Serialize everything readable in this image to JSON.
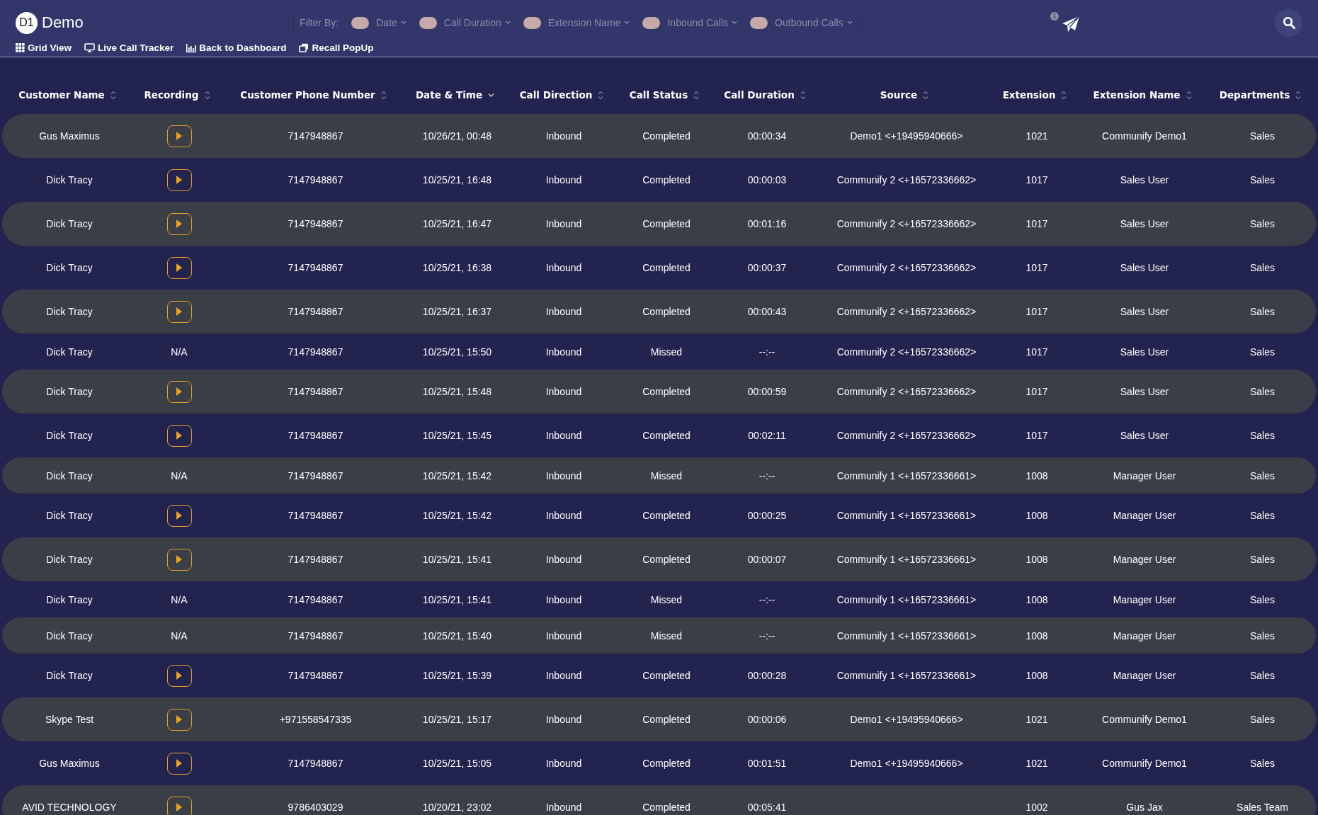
{
  "app": {
    "logo": "D1",
    "title": "Demo"
  },
  "filter": {
    "label": "Filter By:",
    "items": [
      {
        "label": "Date",
        "on": false
      },
      {
        "label": "Call Duration",
        "on": false
      },
      {
        "label": "Extension Name",
        "on": false
      },
      {
        "label": "Inbound Calls",
        "on": false
      },
      {
        "label": "Outbound Calls",
        "on": false
      }
    ]
  },
  "nav": [
    {
      "kind": "grid",
      "label": "Grid View"
    },
    {
      "kind": "monitor",
      "label": "Live Call Tracker"
    },
    {
      "kind": "chart",
      "label": "Back to Dashboard"
    },
    {
      "kind": "popup",
      "label": "Recall PopUp"
    }
  ],
  "table": {
    "columns": [
      {
        "label": "Customer Name",
        "sorted": false
      },
      {
        "label": "Recording",
        "sorted": false
      },
      {
        "label": "Customer Phone Number",
        "sorted": false
      },
      {
        "label": "Date & Time",
        "sorted": true
      },
      {
        "label": "Call Direction",
        "sorted": false
      },
      {
        "label": "Call Status",
        "sorted": false
      },
      {
        "label": "Call Duration",
        "sorted": false
      },
      {
        "label": "Source",
        "sorted": false
      },
      {
        "label": "Extension",
        "sorted": false
      },
      {
        "label": "Extension Name",
        "sorted": false
      },
      {
        "label": "Departments",
        "sorted": false
      }
    ],
    "rows": [
      {
        "name": "Gus Maximus",
        "recording": {
          "kind": "play"
        },
        "phone": "7147948867",
        "datetime": "10/26/21, 00:48",
        "direction": "Inbound",
        "status": "Completed",
        "duration": "00:00:34",
        "source": "Demo1 <+19495940666>",
        "extension": "1021",
        "extension_name": "Communify Demo1",
        "department": "Sales"
      },
      {
        "name": "Dick Tracy",
        "recording": {
          "kind": "play"
        },
        "phone": "7147948867",
        "datetime": "10/25/21, 16:48",
        "direction": "Inbound",
        "status": "Completed",
        "duration": "00:00:03",
        "source": "Communify 2 <+16572336662>",
        "extension": "1017",
        "extension_name": "Sales User",
        "department": "Sales"
      },
      {
        "name": "Dick Tracy",
        "recording": {
          "kind": "play"
        },
        "phone": "7147948867",
        "datetime": "10/25/21, 16:47",
        "direction": "Inbound",
        "status": "Completed",
        "duration": "00:01:16",
        "source": "Communify 2 <+16572336662>",
        "extension": "1017",
        "extension_name": "Sales User",
        "department": "Sales"
      },
      {
        "name": "Dick Tracy",
        "recording": {
          "kind": "play"
        },
        "phone": "7147948867",
        "datetime": "10/25/21, 16:38",
        "direction": "Inbound",
        "status": "Completed",
        "duration": "00:00:37",
        "source": "Communify 2 <+16572336662>",
        "extension": "1017",
        "extension_name": "Sales User",
        "department": "Sales"
      },
      {
        "name": "Dick Tracy",
        "recording": {
          "kind": "play"
        },
        "phone": "7147948867",
        "datetime": "10/25/21, 16:37",
        "direction": "Inbound",
        "status": "Completed",
        "duration": "00:00:43",
        "source": "Communify 2 <+16572336662>",
        "extension": "1017",
        "extension_name": "Sales User",
        "department": "Sales"
      },
      {
        "name": "Dick Tracy",
        "recording": {
          "kind": "text",
          "text": "N/A"
        },
        "phone": "7147948867",
        "datetime": "10/25/21, 15:50",
        "direction": "Inbound",
        "status": "Missed",
        "duration": "--:--",
        "source": "Communify 2 <+16572336662>",
        "extension": "1017",
        "extension_name": "Sales User",
        "department": "Sales"
      },
      {
        "name": "Dick Tracy",
        "recording": {
          "kind": "play"
        },
        "phone": "7147948867",
        "datetime": "10/25/21, 15:48",
        "direction": "Inbound",
        "status": "Completed",
        "duration": "00:00:59",
        "source": "Communify 2 <+16572336662>",
        "extension": "1017",
        "extension_name": "Sales User",
        "department": "Sales"
      },
      {
        "name": "Dick Tracy",
        "recording": {
          "kind": "play"
        },
        "phone": "7147948867",
        "datetime": "10/25/21, 15:45",
        "direction": "Inbound",
        "status": "Completed",
        "duration": "00:02:11",
        "source": "Communify 2 <+16572336662>",
        "extension": "1017",
        "extension_name": "Sales User",
        "department": "Sales"
      },
      {
        "name": "Dick Tracy",
        "recording": {
          "kind": "text",
          "text": "N/A"
        },
        "phone": "7147948867",
        "datetime": "10/25/21, 15:42",
        "direction": "Inbound",
        "status": "Missed",
        "duration": "--:--",
        "source": "Communify 1 <+16572336661>",
        "extension": "1008",
        "extension_name": "Manager User",
        "department": "Sales"
      },
      {
        "name": "Dick Tracy",
        "recording": {
          "kind": "play"
        },
        "phone": "7147948867",
        "datetime": "10/25/21, 15:42",
        "direction": "Inbound",
        "status": "Completed",
        "duration": "00:00:25",
        "source": "Communify 1 <+16572336661>",
        "extension": "1008",
        "extension_name": "Manager User",
        "department": "Sales"
      },
      {
        "name": "Dick Tracy",
        "recording": {
          "kind": "play"
        },
        "phone": "7147948867",
        "datetime": "10/25/21, 15:41",
        "direction": "Inbound",
        "status": "Completed",
        "duration": "00:00:07",
        "source": "Communify 1 <+16572336661>",
        "extension": "1008",
        "extension_name": "Manager User",
        "department": "Sales"
      },
      {
        "name": "Dick Tracy",
        "recording": {
          "kind": "text",
          "text": "N/A"
        },
        "phone": "7147948867",
        "datetime": "10/25/21, 15:41",
        "direction": "Inbound",
        "status": "Missed",
        "duration": "--:--",
        "source": "Communify 1 <+16572336661>",
        "extension": "1008",
        "extension_name": "Manager User",
        "department": "Sales"
      },
      {
        "name": "Dick Tracy",
        "recording": {
          "kind": "text",
          "text": "N/A"
        },
        "phone": "7147948867",
        "datetime": "10/25/21, 15:40",
        "direction": "Inbound",
        "status": "Missed",
        "duration": "--:--",
        "source": "Communify 1 <+16572336661>",
        "extension": "1008",
        "extension_name": "Manager User",
        "department": "Sales"
      },
      {
        "name": "Dick Tracy",
        "recording": {
          "kind": "play"
        },
        "phone": "7147948867",
        "datetime": "10/25/21, 15:39",
        "direction": "Inbound",
        "status": "Completed",
        "duration": "00:00:28",
        "source": "Communify 1 <+16572336661>",
        "extension": "1008",
        "extension_name": "Manager User",
        "department": "Sales"
      },
      {
        "name": "Skype Test",
        "recording": {
          "kind": "play"
        },
        "phone": "+971558547335",
        "datetime": "10/25/21, 15:17",
        "direction": "Inbound",
        "status": "Completed",
        "duration": "00:00:06",
        "source": "Demo1 <+19495940666>",
        "extension": "1021",
        "extension_name": "Communify Demo1",
        "department": "Sales"
      },
      {
        "name": "Gus Maximus",
        "recording": {
          "kind": "play"
        },
        "phone": "7147948867",
        "datetime": "10/25/21, 15:05",
        "direction": "Inbound",
        "status": "Completed",
        "duration": "00:01:51",
        "source": "Demo1 <+19495940666>",
        "extension": "1021",
        "extension_name": "Communify Demo1",
        "department": "Sales"
      },
      {
        "name": "AVID TECHNOLOGY",
        "recording": {
          "kind": "play"
        },
        "phone": "9786403029",
        "datetime": "10/20/21, 23:02",
        "direction": "Inbound",
        "status": "Completed",
        "duration": "00:05:41",
        "extension": "1002",
        "extension_name": "Gus Jax",
        "department": "Sales Team"
      }
    ]
  }
}
